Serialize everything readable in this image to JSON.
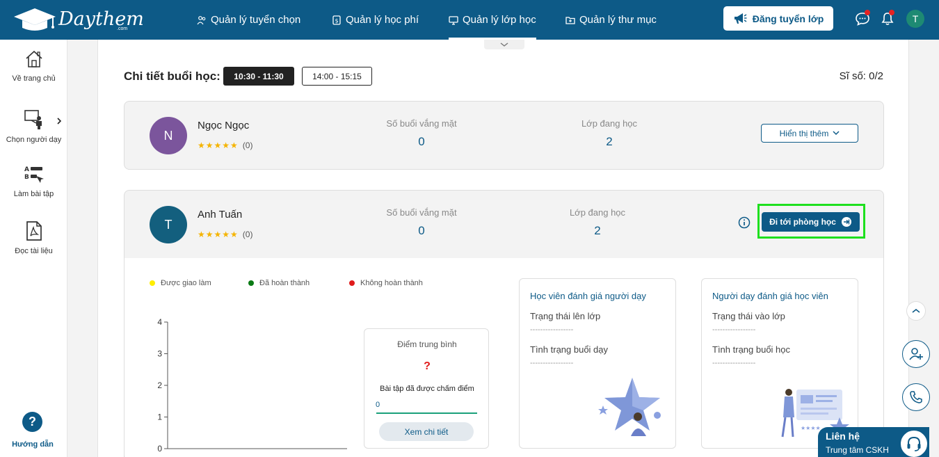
{
  "header": {
    "logo_text": "Daythem",
    "logo_sub": ".com",
    "nav": [
      {
        "label": "Quản lý tuyển chọn",
        "icon": "people-icon"
      },
      {
        "label": "Quản lý học phí",
        "icon": "fee-icon"
      },
      {
        "label": "Quản lý lớp học",
        "icon": "classroom-icon",
        "active": true
      },
      {
        "label": "Quản lý thư mục",
        "icon": "folder-icon"
      }
    ],
    "post_button": "Đăng tuyển lớp",
    "user_initial": "T"
  },
  "sidebar": {
    "items": [
      {
        "label": "Về trang chủ",
        "icon": "home-icon"
      },
      {
        "label": "Chọn người dạy",
        "icon": "teacher-icon"
      },
      {
        "label": "Làm bài tập",
        "icon": "exercise-icon"
      },
      {
        "label": "Đọc tài liệu",
        "icon": "pdf-icon"
      }
    ],
    "help_label": "Hướng dẫn",
    "help_glyph": "?"
  },
  "session": {
    "title": "Chi tiết buổi học:",
    "slots": [
      "10:30 - 11:30",
      "14:00 - 15:15"
    ],
    "active_slot": "10:30 - 11:30",
    "count": "Sĩ số: 0/2"
  },
  "students": [
    {
      "initial": "N",
      "name": "Ngọc Ngọc",
      "stars": "★★★★★",
      "rating_count": "(0)",
      "absent_label": "Số buổi vắng mặt",
      "absent_value": "0",
      "classes_label": "Lớp đang học",
      "classes_value": "2",
      "action": "Hiển thị thêm",
      "color": "#7b559c"
    },
    {
      "initial": "T",
      "name": "Anh Tuấn",
      "stars": "★★★★★",
      "rating_count": "(0)",
      "absent_label": "Số buổi vắng mặt",
      "absent_value": "0",
      "classes_label": "Lớp đang học",
      "classes_value": "2",
      "action": "Đi tới phòng học",
      "color": "#135f7e"
    }
  ],
  "legend": [
    {
      "label": "Được giao làm",
      "color": "#ffee00"
    },
    {
      "label": "Đã hoàn thành",
      "color": "#0a7a14"
    },
    {
      "label": "Không hoàn thành",
      "color": "#e01b1b"
    }
  ],
  "chart_data": {
    "type": "bar",
    "categories": [],
    "series": [],
    "yticks": [
      "4",
      "3",
      "2",
      "1",
      "0"
    ],
    "ylim": [
      0,
      4
    ]
  },
  "score": {
    "title": "Điểm trung bình",
    "value": "?",
    "graded_label": "Bài tập đã được chấm điểm",
    "graded_value": "0",
    "detail_button": "Xem chi tiết"
  },
  "rating_student": {
    "title": "Học viên đánh giá người dạy",
    "label1": "Trạng thái lên lớp",
    "label2": "Tình trạng buổi dạy",
    "dash": "-----------------"
  },
  "rating_teacher": {
    "title": "Người dạy đánh giá học viên",
    "label1": "Trạng thái vào lớp",
    "label2": "Tình trạng buổi học",
    "dash": "-----------------"
  },
  "contact": {
    "title": "Liên hệ",
    "subtitle": "Trung tâm CSKH"
  },
  "colors": {
    "primary": "#0d5a87",
    "highlight": "#1ee01e"
  }
}
